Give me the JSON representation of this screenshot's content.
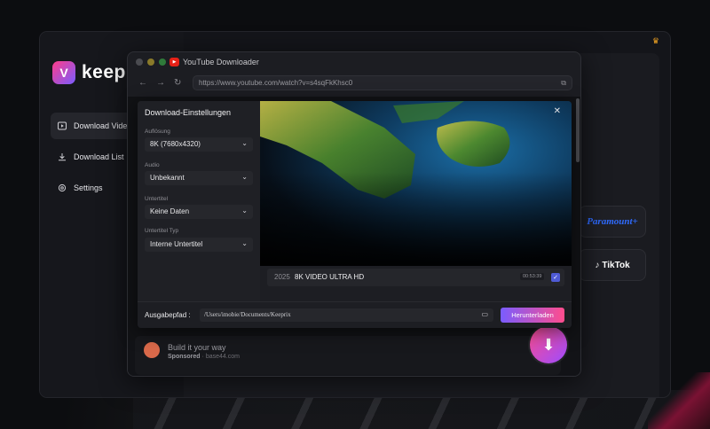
{
  "app": {
    "name": "keeprix",
    "sidebar": {
      "items": [
        {
          "label": "Download Video",
          "icon": "play-square-icon",
          "active": true
        },
        {
          "label": "Download List",
          "icon": "download-icon",
          "active": false
        },
        {
          "label": "Settings",
          "icon": "gear-icon",
          "active": false
        }
      ]
    },
    "services": [
      "Paramount+",
      "TikTok"
    ]
  },
  "yt_window": {
    "title": "YouTube Downloader",
    "url": "https://www.youtube.com/watch?v=s4sqFkKhsc0"
  },
  "dialog": {
    "title": "Download-Einstellungen",
    "fields": [
      {
        "label": "Auflösung",
        "value": "8K (7680x4320)"
      },
      {
        "label": "Audio",
        "value": "Unbekannt"
      },
      {
        "label": "Untertitel",
        "value": "Keine Daten"
      },
      {
        "label": "Untertitel Typ",
        "value": "Interne Untertitel"
      }
    ],
    "video": {
      "year": "2025",
      "title": "8K VIDEO ULTRA HD",
      "duration": "00:53:39"
    },
    "output": {
      "label": "Ausgabepfad :",
      "path": "/Users/imobie/Documents/Keeprix",
      "button": "Herunterladen"
    }
  },
  "ad": {
    "title": "Build it your way",
    "sponsored": "Sponsored",
    "domain": "base44.com"
  },
  "colors": {
    "accent_gradient_start": "#7a5cff",
    "accent_gradient_end": "#ff4d8d"
  }
}
